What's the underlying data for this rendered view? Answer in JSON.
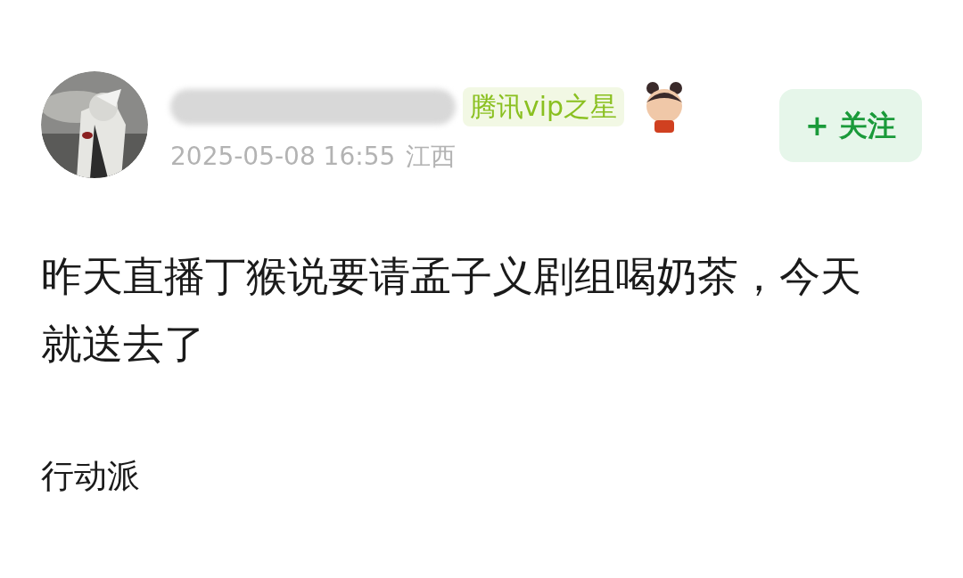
{
  "post": {
    "badge": "腾讯vip之星",
    "time": "2025-05-08 16:55",
    "location": "江西",
    "follow_button": "+ 关注",
    "body": [
      "昨天直播丁猴说要请孟子义剧组喝奶茶，今天就送去了",
      "行动派"
    ]
  }
}
